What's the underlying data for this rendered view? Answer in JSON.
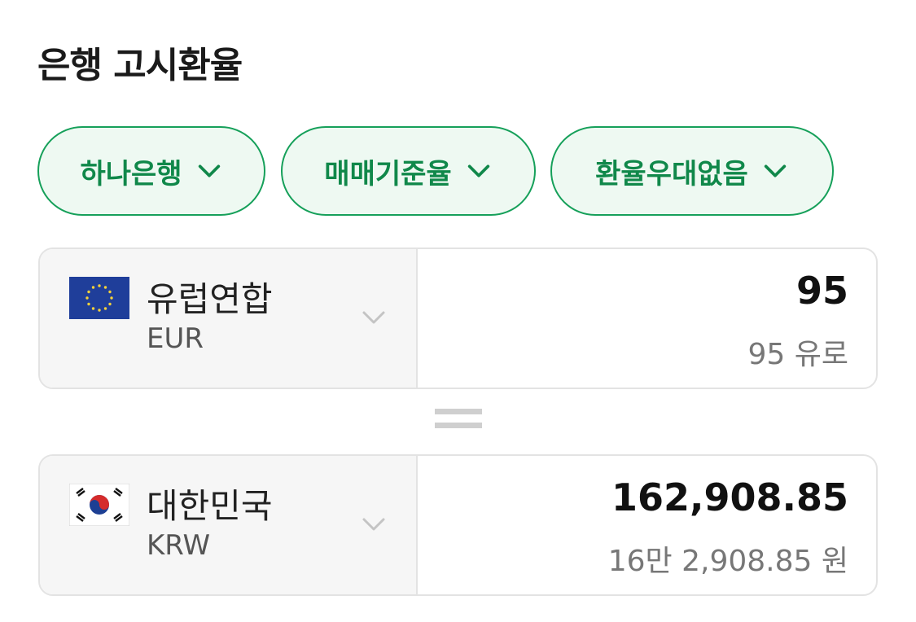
{
  "page": {
    "title": "은행 고시환율"
  },
  "filters": [
    {
      "label": "하나은행"
    },
    {
      "label": "매매기준율"
    },
    {
      "label": "환율우대없음"
    }
  ],
  "from": {
    "country": "유럽연합",
    "currency_code": "EUR",
    "flag_icon": "eu-flag-icon",
    "amount": "95",
    "amount_words": "95 유로"
  },
  "to": {
    "country": "대한민국",
    "currency_code": "KRW",
    "flag_icon": "kr-flag-icon",
    "amount": "162,908.85",
    "amount_words": "16만 2,908.85 원"
  },
  "colors": {
    "accent": "#16a05a",
    "accent_text": "#10884a",
    "chip_bg": "#eef9f2",
    "border": "#e3e3e3",
    "left_panel_bg": "#f6f6f6"
  }
}
